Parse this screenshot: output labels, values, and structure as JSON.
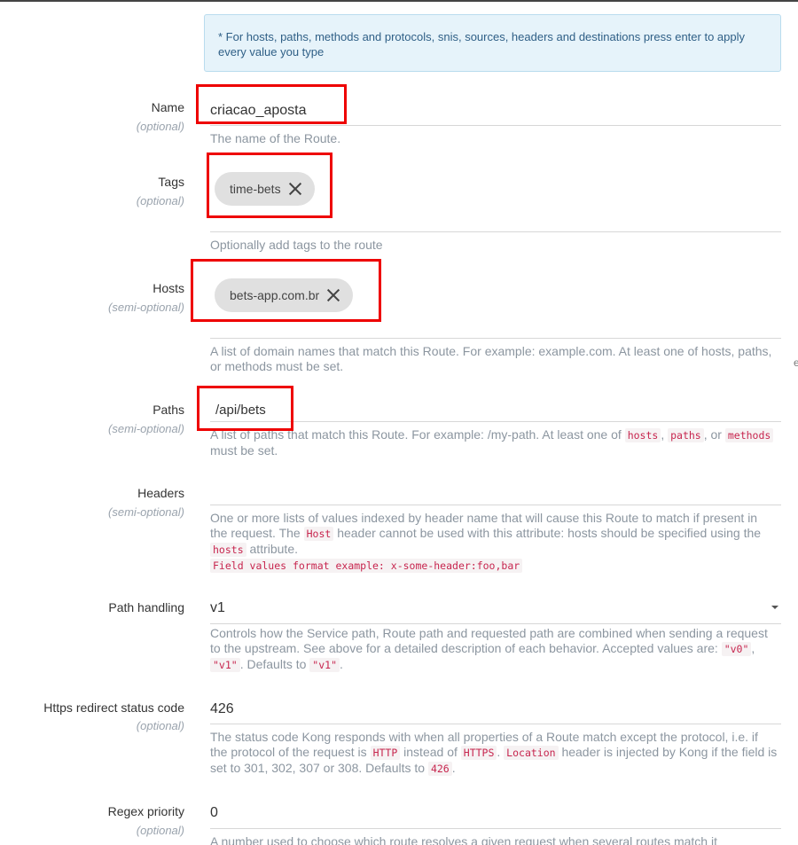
{
  "info_note": "* For hosts, paths, methods and protocols, snis, sources, headers and destinations press enter to apply every value you type",
  "fields": {
    "name": {
      "label": "Name",
      "sub": "(optional)",
      "value": "criacao_aposta",
      "help": "The name of the Route."
    },
    "tags": {
      "label": "Tags",
      "sub": "(optional)",
      "chips": [
        "time-bets"
      ],
      "help": "Optionally add tags to the route"
    },
    "hosts": {
      "label": "Hosts",
      "sub": "(semi-optional)",
      "chips": [
        "bets-app.com.br"
      ],
      "help": "A list of domain names that match this Route. For example: example.com. At least one of hosts, paths, or methods must be set."
    },
    "paths": {
      "label": "Paths",
      "sub": "(semi-optional)",
      "value": "/api/bets",
      "help_pre": "A list of paths that match this Route. For example: /my-path. At least one of",
      "code1": "hosts",
      "sep1": ",",
      "code2": "paths",
      "sep2": ", or",
      "code3": "methods",
      "help_post": "must be set."
    },
    "headers": {
      "label": "Headers",
      "sub": "(semi-optional)",
      "value": "",
      "help_pre": "One or more lists of values indexed by header name that will cause this Route to match if present in the request. The",
      "code1": "Host",
      "help_mid": "header cannot be used with this attribute: hosts should be specified using the",
      "code2": "hosts",
      "help_post": "attribute.",
      "format_example": "Field values format example: x-some-header:foo,bar"
    },
    "path_handling": {
      "label": "Path handling",
      "value": "v1",
      "help_pre": "Controls how the Service path, Route path and requested path are combined when sending a request to the upstream. See above for a detailed description of each behavior. Accepted values are:",
      "code1": "\"v0\"",
      "sep1": ",",
      "code2": "\"v1\"",
      "help_mid": ". Defaults to",
      "code3": "\"v1\"",
      "help_post": "."
    },
    "https_redirect": {
      "label": "Https redirect status code",
      "sub": "(optional)",
      "value": "426",
      "help_pre": "The status code Kong responds with when all properties of a Route match except the protocol, i.e. if the protocol of the request is",
      "code1": "HTTP",
      "help_mid1": "instead of",
      "code2": "HTTPS",
      "help_mid2": ".",
      "code3": "Location",
      "help_mid3": "header is injected by Kong if the field is set to 301, 302, 307 or 308. Defaults to",
      "code4": "426",
      "help_post": "."
    },
    "regex_priority": {
      "label": "Regex priority",
      "sub": "(optional)",
      "value": "0",
      "help": "A number used to choose which route resolves a given request when several routes match it"
    }
  },
  "side_char": "e",
  "colors": {
    "highlight_box": "#ee0000",
    "info_bg": "#e6f3fa",
    "chip_bg": "#e0e0e0"
  }
}
